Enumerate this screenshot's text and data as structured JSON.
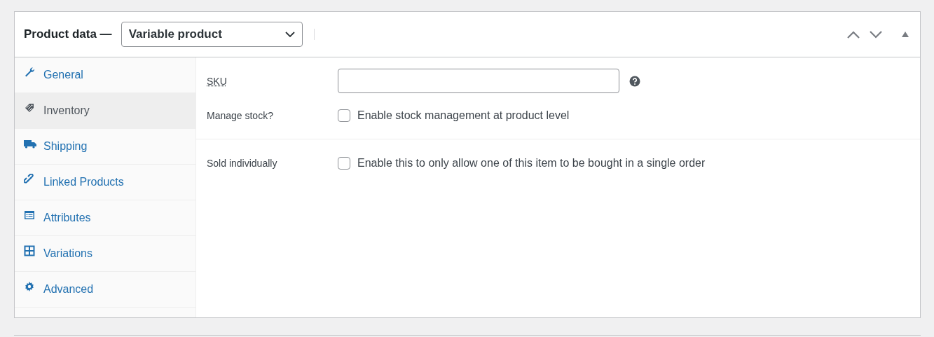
{
  "panel": {
    "title": "Product data —",
    "product_type": {
      "value": "Variable product"
    }
  },
  "tabs": [
    {
      "label": "General",
      "selected": false
    },
    {
      "label": "Inventory",
      "selected": true
    },
    {
      "label": "Shipping",
      "selected": false
    },
    {
      "label": "Linked Products",
      "selected": false
    },
    {
      "label": "Attributes",
      "selected": false
    },
    {
      "label": "Variations",
      "selected": false
    },
    {
      "label": "Advanced",
      "selected": false
    }
  ],
  "sections": [
    {
      "fields": [
        {
          "kind": "text",
          "label": "SKU"
        },
        {
          "kind": "checkbox",
          "label": "Manage stock?",
          "description": "Enable stock management at product level",
          "checked": false
        }
      ]
    },
    {
      "fields": [
        {
          "kind": "checkbox",
          "label": "Sold individually",
          "description": "Enable this to only allow one of this item to be bought in a single order",
          "checked": false
        }
      ]
    }
  ]
}
